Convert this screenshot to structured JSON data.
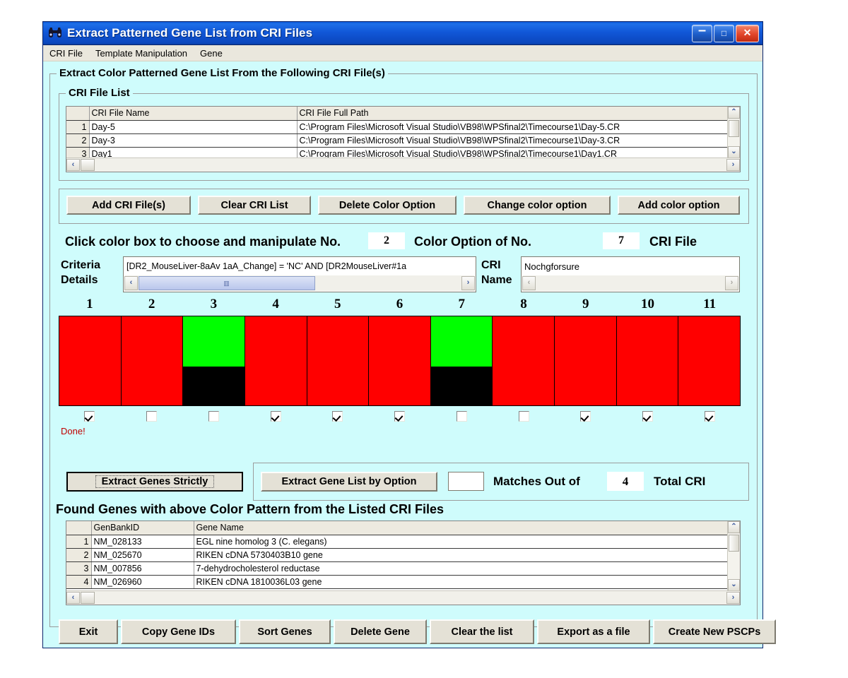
{
  "window": {
    "title": "Extract Patterned Gene List from CRI Files",
    "icon": "binoculars-icon",
    "minimize": "–",
    "maximize": "□",
    "close": "✕",
    "bg_color": "#CFFCFC",
    "titlebar_color": "#1157D8"
  },
  "menu": {
    "items": [
      "CRI File",
      "Template Manipulation",
      "Gene"
    ]
  },
  "outer_frame": {
    "legend": "Extract Color Patterned Gene List  From the Following CRI File(s)"
  },
  "cri_frame": {
    "legend": "CRI File List"
  },
  "cri_table": {
    "headers": [
      "",
      "CRI File Name",
      "CRI File Full Path"
    ],
    "rows": [
      [
        "1",
        "Day-5",
        "C:\\Program Files\\Microsoft Visual Studio\\VB98\\WPSfinal2\\Timecourse1\\Day-5.CR"
      ],
      [
        "2",
        "Day-3",
        "C:\\Program Files\\Microsoft Visual Studio\\VB98\\WPSfinal2\\Timecourse1\\Day-3.CR"
      ],
      [
        "3",
        "Day1",
        "C:\\Program Files\\Microsoft Visual Studio\\VB98\\WPSfinal2\\Timecourse1\\Day1.CR"
      ]
    ],
    "scrollbar_up": "⌃",
    "scrollbar_down": "⌄",
    "scrollbar_left": "‹",
    "scrollbar_right": "›"
  },
  "toolbar": {
    "add_cri_files": "Add CRI File(s)",
    "clear_cri_list": "Clear CRI List",
    "delete_color_option": "Delete Color Option",
    "change_color_option": "Change color option",
    "add_color_option": "Add color option"
  },
  "option_line": {
    "prefix": "Click color box to choose and manipulate No.",
    "option_number": "2",
    "middle": "Color Option  of No.",
    "cri_number": "7",
    "suffix": "CRI File"
  },
  "criteria": {
    "label_line1": "Criteria",
    "label_line2": "Details",
    "value": "[DR2_MouseLiver-8aAv 1aA_Change] = 'NC' AND  [DR2MouseLiver#1a",
    "scroll_left": "‹",
    "scroll_right": "›"
  },
  "cri_name": {
    "label_line1": "CRI",
    "label_line2": "Name",
    "value": "Nochgforsure",
    "scroll_left": "‹",
    "scroll_right": "›"
  },
  "color_pattern": {
    "column_numbers": [
      "1",
      "2",
      "3",
      "4",
      "5",
      "6",
      "7",
      "8",
      "9",
      "10",
      "11"
    ],
    "colors": [
      {
        "top": "#FF0000",
        "bottom": "#FF0000",
        "top_pct": 100
      },
      {
        "top": "#FF0000",
        "bottom": "#FF0000",
        "top_pct": 100
      },
      {
        "top": "#00FF00",
        "bottom": "#000000",
        "top_pct": 56
      },
      {
        "top": "#FF0000",
        "bottom": "#FF0000",
        "top_pct": 100
      },
      {
        "top": "#FF0000",
        "bottom": "#FF0000",
        "top_pct": 100
      },
      {
        "top": "#FF0000",
        "bottom": "#FF0000",
        "top_pct": 100
      },
      {
        "top": "#00FF00",
        "bottom": "#000000",
        "top_pct": 56
      },
      {
        "top": "#FF0000",
        "bottom": "#FF0000",
        "top_pct": 100
      },
      {
        "top": "#FF0000",
        "bottom": "#FF0000",
        "top_pct": 100
      },
      {
        "top": "#FF0000",
        "bottom": "#FF0000",
        "top_pct": 100
      },
      {
        "top": "#FF0000",
        "bottom": "#FF0000",
        "top_pct": 100
      }
    ],
    "checkboxes": [
      true,
      false,
      false,
      true,
      true,
      true,
      false,
      false,
      true,
      true,
      true
    ],
    "status": "Done!",
    "status_color": "#C00000"
  },
  "extract": {
    "strict_button": "Extract Genes Strictly",
    "option_button": "Extract Gene List by Option",
    "matches_value": "",
    "matches_label": "Matches Out of",
    "total_value": "4",
    "total_label": "Total CRI"
  },
  "found_header": "Found Genes with above Color Pattern  from the Listed CRI Files",
  "gene_table": {
    "headers": [
      "",
      "GenBankID",
      "Gene Name"
    ],
    "rows": [
      [
        "1",
        "NM_028133",
        "EGL nine homolog 3 (C. elegans)"
      ],
      [
        "2",
        "NM_025670",
        "RIKEN cDNA 5730403B10 gene"
      ],
      [
        "3",
        "NM_007856",
        "7-dehydrocholesterol reductase"
      ],
      [
        "4",
        "NM_026960",
        "RIKEN cDNA 1810036L03 gene"
      ]
    ],
    "scrollbar_up": "⌃",
    "scrollbar_down": "⌄",
    "scrollbar_left": "‹",
    "scrollbar_right": "›"
  },
  "bottom_bar": {
    "exit": "Exit",
    "copy_gene_ids": "Copy Gene IDs",
    "sort_genes": "Sort Genes",
    "delete_gene": "Delete Gene",
    "clear_the_list": "Clear the list",
    "export_as_a_file": "Export as a file",
    "create_new_pscps": "Create New PSCPs"
  }
}
